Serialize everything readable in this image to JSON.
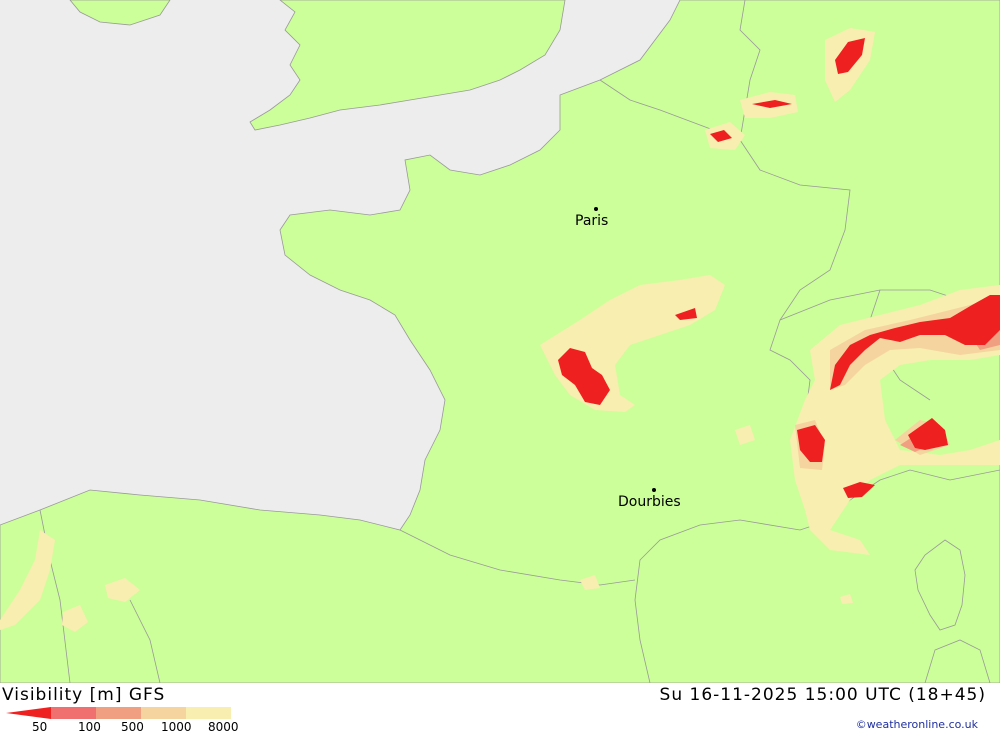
{
  "map": {
    "cities": [
      {
        "name": "Paris"
      },
      {
        "name": "Dourbies"
      }
    ],
    "colors": {
      "sea": "#ededed",
      "land": "#ccff99",
      "border": "#a0a0a0",
      "vis_8000": "#f8eeb0",
      "vis_1000": "#f5d4a0",
      "vis_500": "#f0a080",
      "vis_100": "#f07070",
      "vis_50": "#ee2020"
    }
  },
  "footer": {
    "title": "Visibility [m] GFS",
    "datetime": "Su 16-11-2025 15:00 UTC (18+45)",
    "credit": "©weatheronline.co.uk",
    "legend": {
      "ticks": [
        "50",
        "100",
        "500",
        "1000",
        "8000"
      ],
      "colors": [
        "#ee2020",
        "#f07070",
        "#f0a080",
        "#f5d4a0",
        "#f8eeb0"
      ]
    }
  }
}
